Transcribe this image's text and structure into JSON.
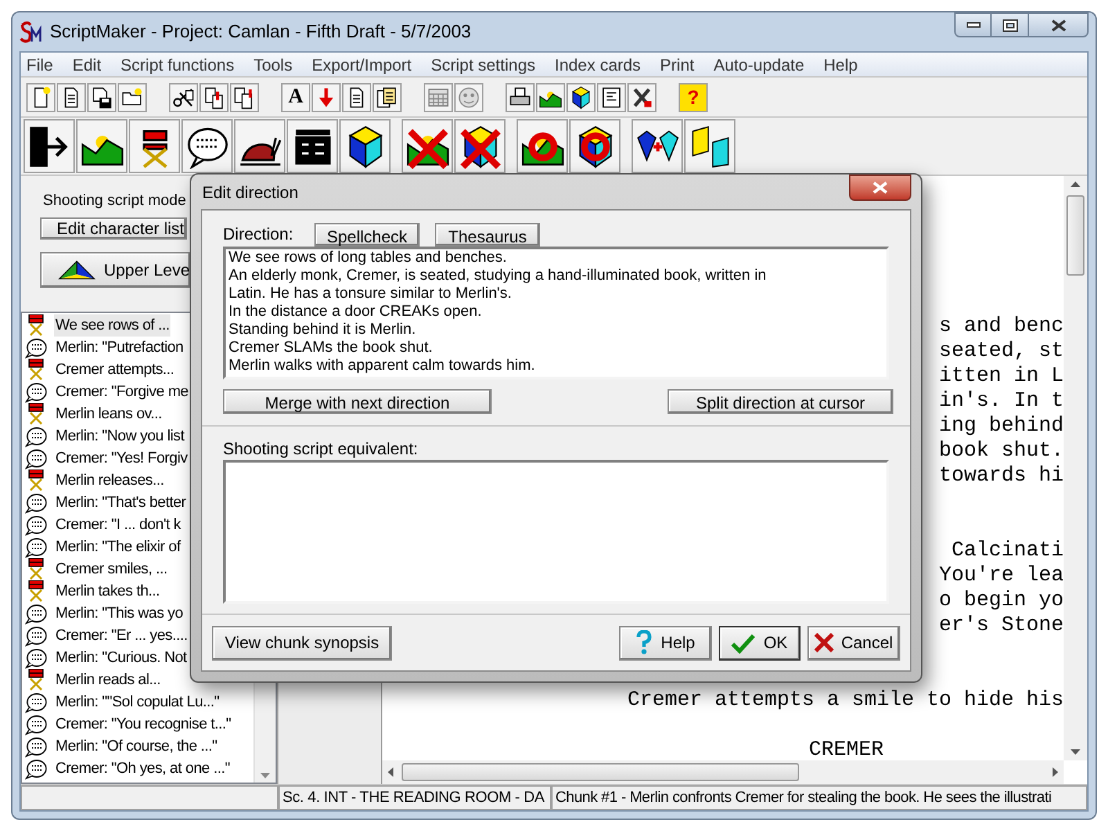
{
  "window": {
    "title": "ScriptMaker - Project: Camlan - Fifth Draft - 5/7/2003"
  },
  "menu": [
    "File",
    "Edit",
    "Script functions",
    "Tools",
    "Export/Import",
    "Script settings",
    "Index cards",
    "Print",
    "Auto-update",
    "Help"
  ],
  "toolbar": {
    "font_glyph": "A",
    "help_glyph": "?"
  },
  "left_panel": {
    "mode_label": "Shooting script mode",
    "edit_characters_button": "Edit character list",
    "upper_level_button": "Upper Leve"
  },
  "chunk_list": [
    {
      "kind": "direction",
      "text": "We see rows of ...",
      "selected": true
    },
    {
      "kind": "dialogue",
      "text": "Merlin: \"Putrefaction",
      "selected": false
    },
    {
      "kind": "direction",
      "text": "Cremer attempts...",
      "selected": false
    },
    {
      "kind": "dialogue",
      "text": "Cremer: \"Forgive me",
      "selected": false
    },
    {
      "kind": "direction",
      "text": "Merlin leans ov...",
      "selected": false
    },
    {
      "kind": "dialogue",
      "text": "Merlin: \"Now you list",
      "selected": false
    },
    {
      "kind": "dialogue",
      "text": "Cremer: \"Yes! Forgiv",
      "selected": false
    },
    {
      "kind": "direction",
      "text": "Merlin releases...",
      "selected": false
    },
    {
      "kind": "dialogue",
      "text": "Merlin: \"That's better",
      "selected": false
    },
    {
      "kind": "dialogue",
      "text": "Cremer: \"I ... don't k",
      "selected": false
    },
    {
      "kind": "dialogue",
      "text": "Merlin: \"The elixir of",
      "selected": false
    },
    {
      "kind": "direction",
      "text": "Cremer smiles, ...",
      "selected": false
    },
    {
      "kind": "direction",
      "text": "Merlin takes th...",
      "selected": false
    },
    {
      "kind": "dialogue",
      "text": "Merlin: \"This was yo",
      "selected": false
    },
    {
      "kind": "dialogue",
      "text": "Cremer: \"Er ... yes....",
      "selected": false
    },
    {
      "kind": "dialogue",
      "text": "Merlin: \"Curious. Not",
      "selected": false
    },
    {
      "kind": "direction",
      "text": "Merlin reads al...",
      "selected": false
    },
    {
      "kind": "dialogue",
      "text": "Merlin: \"\"Sol copulat Lu...\"",
      "selected": false
    },
    {
      "kind": "dialogue",
      "text": "Cremer: \"You recognise t...\"",
      "selected": false
    },
    {
      "kind": "dialogue",
      "text": "Merlin: \"Of course, the ...\"",
      "selected": false
    },
    {
      "kind": "dialogue",
      "text": "Cremer: \"Oh yes, at one ...\"",
      "selected": false
    }
  ],
  "script_blocks": [
    {
      "kind": "action",
      "lines": [
        "s and benc",
        "seated, st",
        "itten in L",
        "in's. In t",
        "ing behind",
        "book shut.",
        "towards hi"
      ]
    },
    {
      "kind": "dialogue",
      "lines": [
        "Calcinati",
        "You're lea",
        "o begin yo",
        "er's Stone"
      ]
    },
    {
      "kind": "action",
      "lines": [
        "Cremer attempts a smile to hide his"
      ]
    },
    {
      "kind": "character",
      "lines": [
        "CREMER"
      ]
    }
  ],
  "status_bar": {
    "scene": "Sc. 4. INT - THE READING ROOM - DA",
    "chunk": "Chunk #1 - Merlin confronts Cremer for stealing the book. He sees the illustrati"
  },
  "dialog": {
    "title": "Edit direction",
    "direction_label": "Direction:",
    "spellcheck_button": "Spellcheck",
    "thesaurus_button": "Thesaurus",
    "direction_text": "We see rows of long tables and benches.\nAn elderly monk, Cremer, is seated, studying a hand-illuminated book, written in\nLatin. He has a tonsure similar to Merlin's.\nIn the distance a door CREAKs open.\nStanding behind it is Merlin.\nCremer SLAMs the book shut.\nMerlin walks with apparent calm towards him.",
    "merge_button": "Merge with next direction",
    "split_button": "Split direction at cursor",
    "shooting_label": "Shooting script equivalent:",
    "synopsis_button": "View chunk synopsis",
    "help_button": "Help",
    "ok_button": "OK",
    "cancel_button": "Cancel"
  }
}
